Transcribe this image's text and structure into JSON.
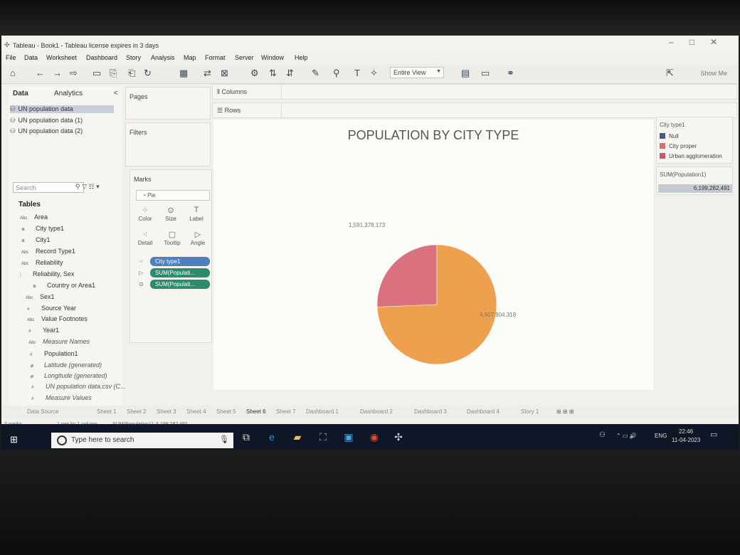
{
  "window": {
    "title": "Tableau - Book1 - Tableau license expires in 3 days",
    "controls": [
      "–",
      "□",
      "✕"
    ]
  },
  "menu": [
    "File",
    "Data",
    "Worksheet",
    "Dashboard",
    "Story",
    "Analysis",
    "Map",
    "Format",
    "Server",
    "Window",
    "Help"
  ],
  "toolbar": {
    "view_select": "Entire View",
    "show_me": "Show Me"
  },
  "data_pane": {
    "tabs": [
      "Data",
      "Analytics"
    ],
    "collapse_glyph": "<",
    "datasources": [
      "UN population data",
      "UN population data (1)",
      "UN population data (2)"
    ],
    "search_placeholder": "Search",
    "tables_heading": "Tables",
    "fields": [
      {
        "type": "Abc",
        "name": "Area"
      },
      {
        "type": "⊕",
        "name": "City type1"
      },
      {
        "type": "⊕",
        "name": "City1"
      },
      {
        "type": "Abc",
        "name": "Record Type1"
      },
      {
        "type": "Abc",
        "name": "Reliability"
      },
      {
        "type": "⋮",
        "name": "Reliability, Sex"
      },
      {
        "type": "⊕",
        "name": "Country or Area1"
      },
      {
        "type": "Abc",
        "name": "Sex1"
      },
      {
        "type": "#",
        "name": "Source Year"
      },
      {
        "type": "Abc",
        "name": "Value Footnotes"
      },
      {
        "type": "#",
        "name": "Year1"
      },
      {
        "type": "Abc",
        "name": "Measure Names"
      },
      {
        "type": "#",
        "name": "Population1"
      },
      {
        "type": "⊕",
        "name": "Latitude (generated)"
      },
      {
        "type": "⊕",
        "name": "Longitude (generated)"
      },
      {
        "type": "#",
        "name": "UN population data.csv (C..."
      },
      {
        "type": "#",
        "name": "Measure Values"
      }
    ]
  },
  "cards": {
    "pages": "Pages",
    "filters": "Filters",
    "marks": "Marks",
    "mark_type": "Pie",
    "mark_buttons": [
      "Color",
      "Size",
      "Label",
      "Detail",
      "Tooltip",
      "Angle"
    ],
    "pills": [
      "City type1",
      "SUM(Populati...",
      "SUM(Populati..."
    ]
  },
  "shelves": {
    "columns": "Columns",
    "rows": "Rows"
  },
  "view": {
    "title": "POPULATION BY CITY TYPE"
  },
  "legend": {
    "title": "City type1",
    "items": [
      {
        "label": "Null",
        "color": "#4a5a86"
      },
      {
        "label": "City proper",
        "color": "#d6706a"
      },
      {
        "label": "Urban agglomeration",
        "color": "#c8586a"
      }
    ]
  },
  "size_legend": {
    "title": "SUM(Population1)",
    "value": "6,199,282,491"
  },
  "chart_data": {
    "type": "pie",
    "title": "POPULATION BY CITY TYPE",
    "categories": [
      "Urban agglomeration",
      "City proper"
    ],
    "values": [
      1591378173,
      4607904318
    ],
    "labels": [
      "1,591,378,173",
      "4,607,904,318"
    ],
    "colors": [
      "#d9727e",
      "#eea04e"
    ],
    "legend": "right",
    "total": 6199282491
  },
  "sheet_tabs": [
    "Data Source",
    "Sheet 1",
    "Sheet 2",
    "Sheet 3",
    "Sheet 4",
    "Sheet 5",
    "Sheet 6",
    "Sheet 7",
    "Dashboard 1",
    "Dashboard 2",
    "Dashboard 3",
    "Dashboard 4",
    "Story 1"
  ],
  "active_sheet": "Sheet 6",
  "status": {
    "marks": "3 marks",
    "rowcol": "1 row by 1 column",
    "sum": "SUM(Population1): 6,199,282,491"
  },
  "taskbar": {
    "search_placeholder": "Type here to search",
    "lang": "ENG",
    "time": "22:46",
    "date": "11-04-2023"
  }
}
